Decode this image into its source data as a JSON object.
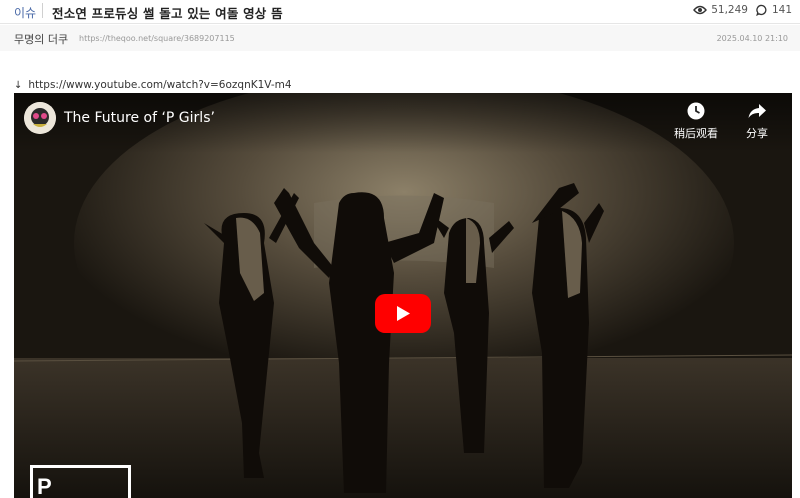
{
  "post": {
    "category": "이슈",
    "title": "전소연 프로듀싱 썰 돌고 있는 여돌 영상 뜸",
    "views": "51,249",
    "comments": "141",
    "author": "무명의 더쿠",
    "url": "https://theqoo.net/square/3689207115",
    "date": "2025.04.10 21:10",
    "link_arrow": "↓",
    "link": "https://www.youtube.com/watch?v=6ozqnK1V-m4"
  },
  "video": {
    "title": "The Future of ‘P Girls’",
    "watch_later_label": "稍后观看",
    "share_label": "分享",
    "logo_text": "P"
  },
  "colors": {
    "category": "#4a6aa8",
    "youtube_red": "#ff0000",
    "video_bg": "#191510"
  },
  "icons": [
    "eye-icon",
    "comment-icon",
    "clock-icon",
    "share-arrow-icon",
    "play-icon"
  ]
}
